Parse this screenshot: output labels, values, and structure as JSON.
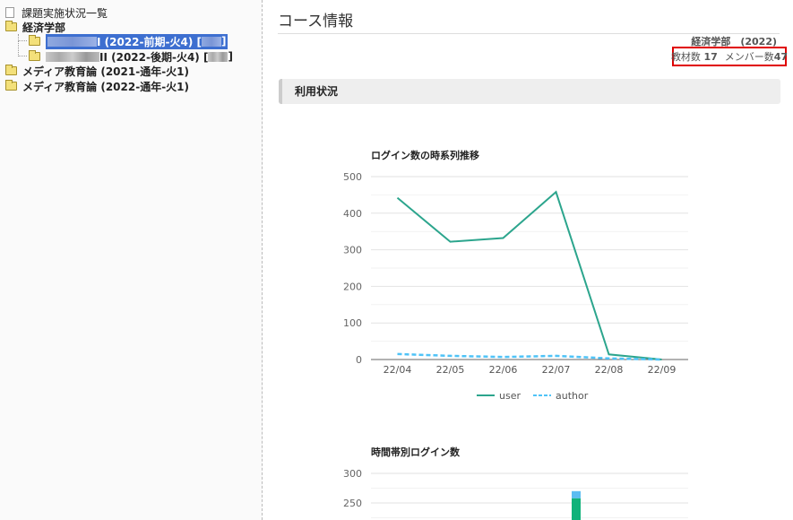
{
  "sidebar": {
    "items": [
      {
        "label": "課題実施状況一覧",
        "icon": "document-icon"
      },
      {
        "label": "経済学部",
        "icon": "folder-open-icon"
      },
      {
        "label": "I (2022-前期-火4) [",
        "suffix": "]",
        "icon": "folder-icon",
        "selected": true
      },
      {
        "label": "II (2022-後期-火4) [",
        "suffix": "]",
        "icon": "folder-icon"
      },
      {
        "label": "メディア教育論 (2021-通年-火1)",
        "icon": "folder-icon"
      },
      {
        "label": "メディア教育論 (2022-通年-火1)",
        "icon": "folder-icon"
      }
    ]
  },
  "main": {
    "title": "コース情報",
    "department": "経済学部　(2022)",
    "materials_label": "教材数",
    "materials_count": "17",
    "members_label": "メンバー数",
    "members_count": "47",
    "section": "利用状況"
  },
  "chart_data": [
    {
      "type": "line",
      "title": "ログイン数の時系列推移",
      "categories": [
        "22/04",
        "22/05",
        "22/06",
        "22/07",
        "22/08",
        "22/09"
      ],
      "series": [
        {
          "name": "user",
          "values": [
            442,
            322,
            332,
            458,
            14,
            0
          ],
          "color": "#2ca58d",
          "style": "solid"
        },
        {
          "name": "author",
          "values": [
            15,
            10,
            7,
            10,
            3,
            0
          ],
          "color": "#4fc3f7",
          "style": "dashed"
        }
      ],
      "ylim": [
        0,
        500
      ],
      "yticks": [
        0,
        100,
        200,
        300,
        400,
        500
      ],
      "grid": true,
      "legend": "bottom"
    },
    {
      "type": "bar",
      "stacked": true,
      "title": "時間帯別ログイン数",
      "yticks_visible": [
        250,
        300
      ],
      "series": [
        {
          "values": [
            258
          ],
          "color": "#10b27a"
        },
        {
          "values": [
            12
          ],
          "color": "#5bbcf2"
        }
      ]
    }
  ]
}
